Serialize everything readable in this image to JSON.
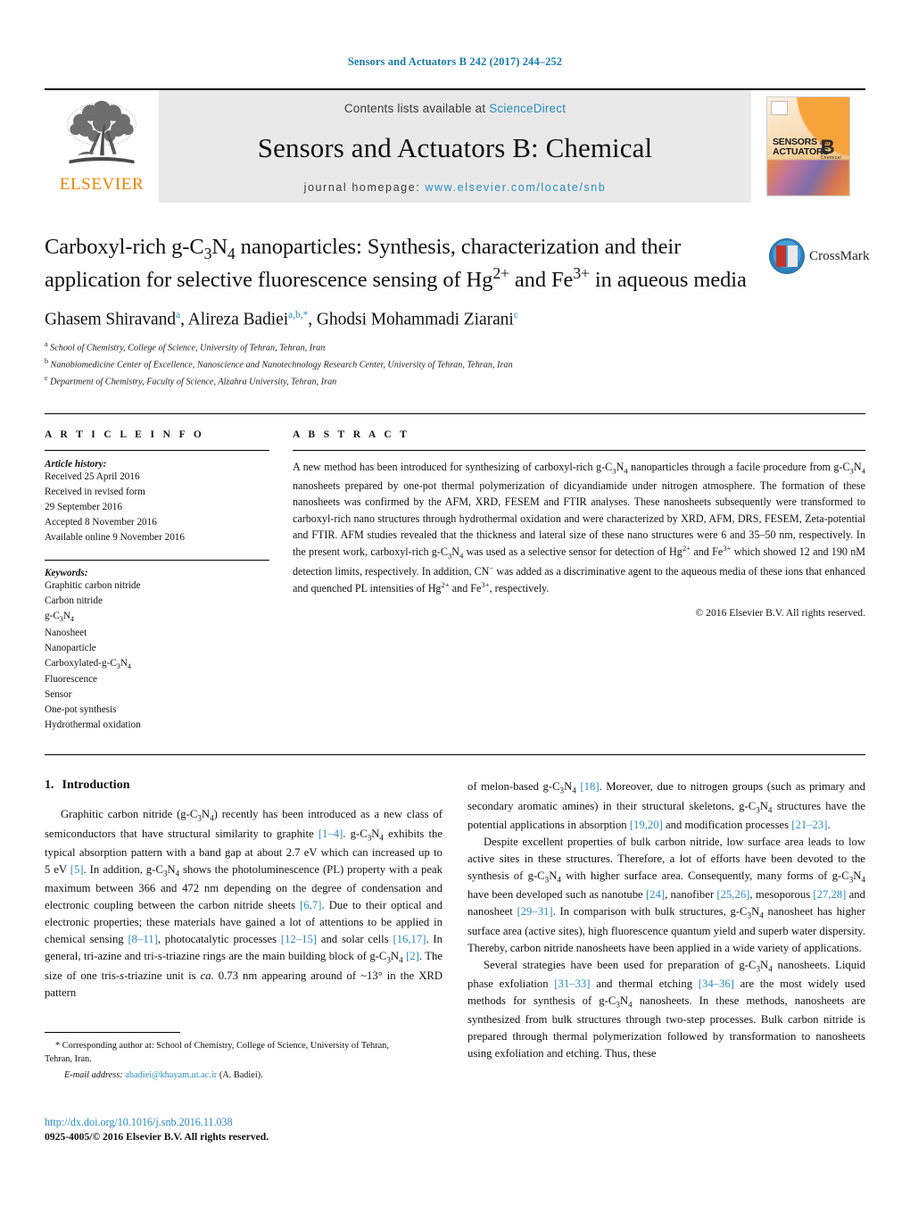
{
  "running_head": "Sensors and Actuators B 242 (2017) 244–252",
  "masthead": {
    "publisher_logo_name": "elsevier-tree-logo",
    "publisher_wordmark": "ELSEVIER",
    "contents_prefix": "Contents lists available at ",
    "contents_link": "ScienceDirect",
    "journal_title": "Sensors and Actuators B: Chemical",
    "homepage_prefix": "journal homepage: ",
    "homepage_url": "www.elsevier.com/locate/snb",
    "cover": {
      "line1": "SENSORS",
      "and": "and",
      "line2": "ACTUATORS",
      "letter": "B",
      "letter_sub": "Chemical"
    }
  },
  "article": {
    "title_part1": "Carboxyl-rich g-C",
    "title_sub1": "3",
    "title_part2": "N",
    "title_sub2": "4",
    "title_part3": " nanoparticles: Synthesis, characterization and their application for selective fluorescence sensing of Hg",
    "title_sup1": "2+",
    "title_part4": " and Fe",
    "title_sup2": "3+",
    "title_part5": " in aqueous media",
    "crossmark_label": "CrossMark",
    "authors_plain": "Ghasem Shiravand a, Alireza Badiei a,b,*, Ghodsi Mohammadi Ziarani c",
    "affiliations": [
      {
        "marker": "a",
        "text": "School of Chemistry, College of Science, University of Tehran, Tehran, Iran"
      },
      {
        "marker": "b",
        "text": "Nanobiomedicine Center of Excellence, Nanoscience and Nanotechnology Research Center, University of Tehran, Tehran, Iran"
      },
      {
        "marker": "c",
        "text": "Department of Chemistry, Faculty of Science, Alzahra University, Tehran, Iran"
      }
    ]
  },
  "article_info": {
    "heading": "A R T I C L E   I N F O",
    "history_label": "Article history:",
    "history": [
      "Received 25 April 2016",
      "Received in revised form",
      "29 September 2016",
      "Accepted 8 November 2016",
      "Available online 9 November 2016"
    ],
    "keywords_label": "Keywords:",
    "keywords": [
      "Graphitic carbon nitride",
      "Carbon nitride",
      "g-C3N4",
      "Nanosheet",
      "Nanoparticle",
      "Carboxylated-g-C3N4",
      "Fluorescence",
      "Sensor",
      "One-pot synthesis",
      "Hydrothermal oxidation"
    ]
  },
  "abstract": {
    "heading": "A B S T R A C T",
    "text": "A new method has been introduced for synthesizing of carboxyl-rich g-C3N4 nanoparticles through a facile procedure from g-C3N4 nanosheets prepared by one-pot thermal polymerization of dicyandiamide under nitrogen atmosphere. The formation of these nanosheets was confirmed by the AFM, XRD, FESEM and FTIR analyses. These nanosheets subsequently were transformed to carboxyl-rich nano structures through hydrothermal oxidation and were characterized by XRD, AFM, DRS, FESEM, Zeta-potential and FTIR. AFM studies revealed that the thickness and lateral size of these nano structures were 6 and 35–50 nm, respectively. In the present work, carboxyl-rich g-C3N4 was used as a selective sensor for detection of Hg2+ and Fe3+ which showed 12 and 190 nM detection limits, respectively. In addition, CN− was added as a discriminative agent to the aqueous media of these ions that enhanced and quenched PL intensities of Hg2+ and Fe3+, respectively.",
    "copyright": "© 2016 Elsevier B.V. All rights reserved."
  },
  "body": {
    "section_number": "1.",
    "section_title": "Introduction",
    "left_paragraph_1": "Graphitic carbon nitride (g-C3N4) recently has been introduced as a new class of semiconductors that have structural similarity to graphite [1–4]. g-C3N4 exhibits the typical absorption pattern with a band gap at about 2.7 eV which can increased up to 5 eV [5]. In addition, g-C3N4 shows the photoluminescence (PL) property with a peak maximum between 366 and 472 nm depending on the degree of condensation and electronic coupling between the carbon nitride sheets [6,7]. Due to their optical and electronic properties; these materials have gained a lot of attentions to be applied in chemical sensing [8–11], photocatalytic processes [12–15] and solar cells [16,17]. In general, tri-azine and tri-s-triazine rings are the main building block of g-C3N4 [2]. The size of one tris-s-triazine unit is ca. 0.73 nm appearing around of ~13° in the XRD pattern",
    "right_paragraph_1": "of melon-based g-C3N4 [18]. Moreover, due to nitrogen groups (such as primary and secondary aromatic amines) in their structural skeletons, g-C3N4 structures have the potential applications in absorption [19,20] and modification processes [21–23].",
    "right_paragraph_2": "Despite excellent properties of bulk carbon nitride, low surface area leads to low active sites in these structures. Therefore, a lot of efforts have been devoted to the synthesis of g-C3N4 with higher surface area. Consequently, many forms of g-C3N4 have been developed such as nanotube [24], nanofiber [25,26], mesoporous [27,28] and nanosheet [29–31]. In comparison with bulk structures, g-C3N4 nanosheet has higher surface area (active sites), high fluorescence quantum yield and superb water dispersity. Thereby, carbon nitride nanosheets have been applied in a wide variety of applications.",
    "right_paragraph_3": "Several strategies have been used for preparation of g-C3N4 nanosheets. Liquid phase exfoliation [31–33] and thermal etching [34–36] are the most widely used methods for synthesis of g-C3N4 nanosheets. In these methods, nanosheets are synthesized from bulk structures through two-step processes. Bulk carbon nitride is prepared through thermal polymerization followed by transformation to nanosheets using exfoliation and etching. Thus, these"
  },
  "footnote": {
    "star": "*",
    "text": "Corresponding author at: School of Chemistry, College of Science, University of Tehran, Tehran, Iran.",
    "email_label": "E-mail address:",
    "email": "abadiei@khayam.ut.ac.ir",
    "email_owner": "(A. Badiei)."
  },
  "footer": {
    "doi": "http://dx.doi.org/10.1016/j.snb.2016.11.038",
    "issn_line": "0925-4005/© 2016 Elsevier B.V. All rights reserved."
  },
  "colors": {
    "link_blue": "#2b8bbd",
    "running_head_blue": "#1a7bac",
    "elsevier_orange": "#ef8200",
    "masthead_gray": "#e9e9e9"
  }
}
